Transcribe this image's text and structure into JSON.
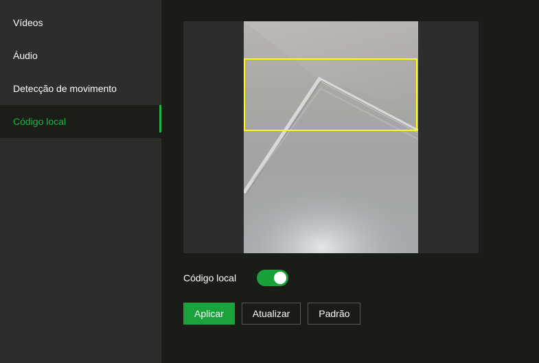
{
  "sidebar": {
    "items": [
      {
        "label": "Vídeos",
        "active": false
      },
      {
        "label": "Áudio",
        "active": false
      },
      {
        "label": "Detecção de movimento",
        "active": false
      },
      {
        "label": "Código local",
        "active": true
      }
    ]
  },
  "main": {
    "toggle": {
      "label": "Código local",
      "enabled": true
    },
    "buttons": {
      "apply": "Aplicar",
      "refresh": "Atualizar",
      "default": "Padrão"
    }
  },
  "colors": {
    "accent": "#1fb544",
    "region_border": "#ffff00",
    "sidebar_bg": "#2c2e2c",
    "main_bg": "#1a1c18"
  }
}
